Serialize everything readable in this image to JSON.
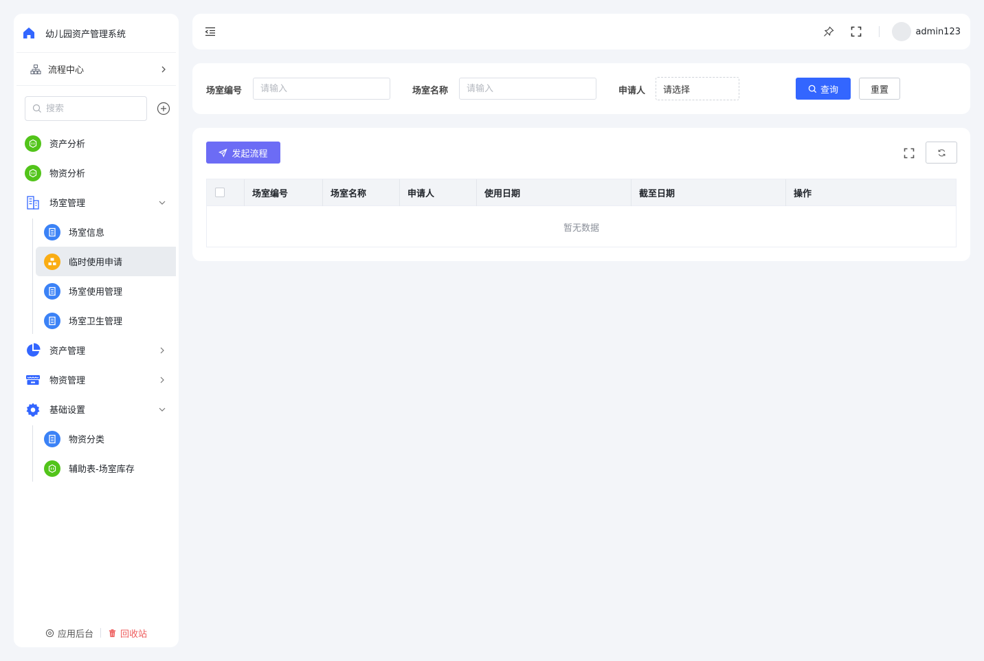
{
  "app": {
    "title": "幼儿园资产管理系统"
  },
  "sidebar": {
    "flow_center": "流程中心",
    "search_placeholder": "搜索",
    "menu": [
      {
        "label": "资产分析",
        "icon": "green-hex-icon"
      },
      {
        "label": "物资分析",
        "icon": "green-hex-icon"
      },
      {
        "label": "场室管理",
        "icon": "building-icon",
        "expanded": true
      },
      {
        "label": "场室信息",
        "icon": "blue-doc-icon"
      },
      {
        "label": "临时使用申请",
        "icon": "orange-org-icon",
        "active": true
      },
      {
        "label": "场室使用管理",
        "icon": "blue-doc-icon"
      },
      {
        "label": "场室卫生管理",
        "icon": "blue-doc-icon"
      },
      {
        "label": "资产管理",
        "icon": "pie-icon"
      },
      {
        "label": "物资管理",
        "icon": "store-icon"
      },
      {
        "label": "基础设置",
        "icon": "gear-icon",
        "expanded": true
      },
      {
        "label": "物资分类",
        "icon": "blue-doc-icon"
      },
      {
        "label": "辅助表-场室库存",
        "icon": "green-hex-icon"
      }
    ],
    "footer": {
      "admin": "应用后台",
      "recycle": "回收站"
    }
  },
  "header": {
    "username": "admin123"
  },
  "filter": {
    "room_code_label": "场室编号",
    "room_code_placeholder": "请输入",
    "room_name_label": "场室名称",
    "room_name_placeholder": "请输入",
    "applicant_label": "申请人",
    "applicant_placeholder": "请选择",
    "query_label": "查询",
    "reset_label": "重置"
  },
  "table": {
    "start_flow_label": "发起流程",
    "columns": [
      "场室编号",
      "场室名称",
      "申请人",
      "使用日期",
      "截至日期",
      "操作"
    ],
    "empty_text": "暂无数据"
  },
  "colors": {
    "primary": "#3366ff",
    "start_button": "#6c6cf5",
    "green_icon": "#52c41a",
    "orange_icon": "#faad14",
    "recycle_red": "#ee5b5b"
  }
}
